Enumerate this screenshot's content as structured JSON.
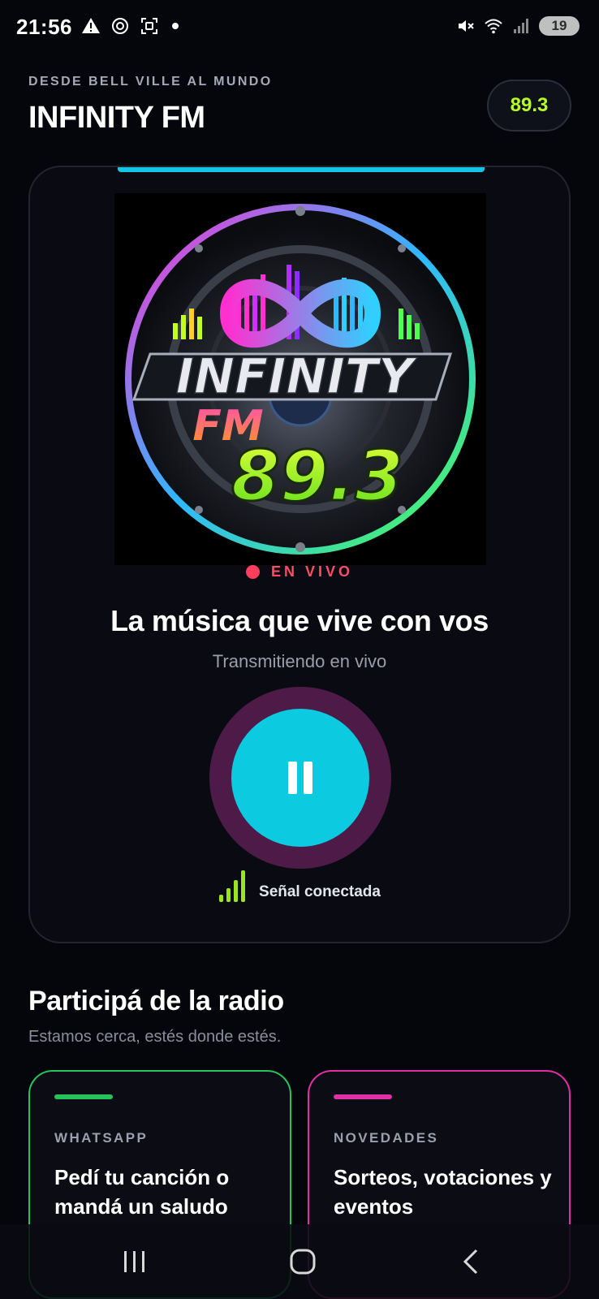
{
  "status_bar": {
    "time": "21:56",
    "battery": "19",
    "icons_left": [
      "warning-icon",
      "chatgpt-icon",
      "screenshot-icon",
      "notification-dot"
    ],
    "icons_right": [
      "mute-vibrate-icon",
      "wifi-icon",
      "cell-signal-icon",
      "battery-icon"
    ]
  },
  "header": {
    "subtitle": "DESDE BELL VILLE AL MUNDO",
    "title": "INFINITY FM",
    "frequency": "89.3"
  },
  "player": {
    "cover_alt": "Infinity FM 89.3 logo",
    "cover_logo": {
      "word1": "INFINITY",
      "word2": "FM",
      "number": "89.3"
    },
    "live_label": "EN VIVO",
    "tagline": "La música que vive con vos",
    "status": "Transmitiendo en vivo",
    "button_state": "pause-icon",
    "signal_text": "Señal conectada"
  },
  "participate": {
    "title": "Participá de la radio",
    "subtitle": "Estamos cerca, estés donde estés.",
    "cards": [
      {
        "label": "WHATSAPP",
        "text": "Pedí tu canción o mandá un saludo",
        "color": "#26c35c"
      },
      {
        "label": "NOVEDADES",
        "text": "Sorteos, votaciones y eventos",
        "color": "#e12fa6"
      }
    ]
  },
  "navbar": {
    "icons": [
      "recent-apps-icon",
      "home-icon",
      "back-icon"
    ]
  },
  "colors": {
    "background": "#05060c",
    "accent_cyan": "#0ccbe0",
    "accent_lime": "#b6ff1f",
    "live_red": "#ff3d5d",
    "ring_purple": "#4e1b49"
  }
}
